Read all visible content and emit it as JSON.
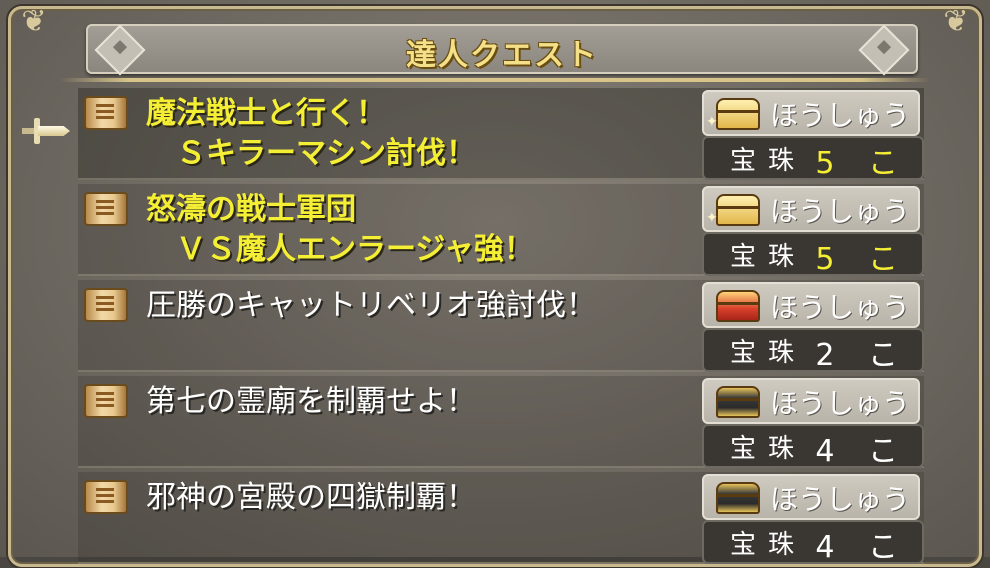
{
  "header": {
    "title": "達人クエスト"
  },
  "quests": [
    {
      "title_line1": "魔法戦士と行く！",
      "title_line2": "　Ｓキラーマシン討伐！",
      "completed": false,
      "reward": {
        "label": "ほうしゅう",
        "item": "宝珠",
        "count": "5 こ",
        "chest": "gold"
      }
    },
    {
      "title_line1": "怒濤の戦士軍団",
      "title_line2": "　ＶＳ魔人エンラージャ強！",
      "completed": false,
      "reward": {
        "label": "ほうしゅう",
        "item": "宝珠",
        "count": "5 こ",
        "chest": "gold"
      }
    },
    {
      "title_line1": "圧勝のキャットリベリオ強討伐！",
      "title_line2": "",
      "completed": true,
      "reward": {
        "label": "ほうしゅう",
        "item": "宝珠",
        "count": "2 こ",
        "chest": "red"
      }
    },
    {
      "title_line1": "第七の霊廟を制覇せよ！",
      "title_line2": "",
      "completed": true,
      "reward": {
        "label": "ほうしゅう",
        "item": "宝珠",
        "count": "4 こ",
        "chest": "dark"
      }
    },
    {
      "title_line1": "邪神の宮殿の四獄制覇！",
      "title_line2": "",
      "completed": true,
      "reward": {
        "label": "ほうしゅう",
        "item": "宝珠",
        "count": "4 こ",
        "chest": "dark"
      }
    }
  ],
  "colors": {
    "highlight_text": "#f4ef34",
    "normal_text": "#ffffff",
    "title_gold": "#f5e08a"
  },
  "icons": {
    "quest": "scroll-icon",
    "reward": "treasure-chest-icon",
    "cursor": "sword-cursor-icon"
  }
}
